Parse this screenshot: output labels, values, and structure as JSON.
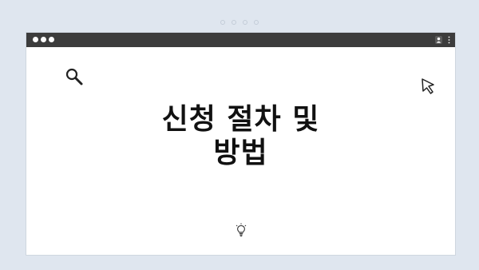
{
  "window": {
    "titlebar_color": "#3c3c3c",
    "icons": [
      "user-icon",
      "kebab-menu-icon"
    ]
  },
  "content": {
    "headline_line1": "신청 절차 및",
    "headline_line2": "방법",
    "icons": [
      "search-icon",
      "cursor-icon",
      "lightbulb-icon"
    ]
  },
  "colors": {
    "background": "#dfe6ef",
    "window": "#ffffff",
    "text": "#111111"
  }
}
